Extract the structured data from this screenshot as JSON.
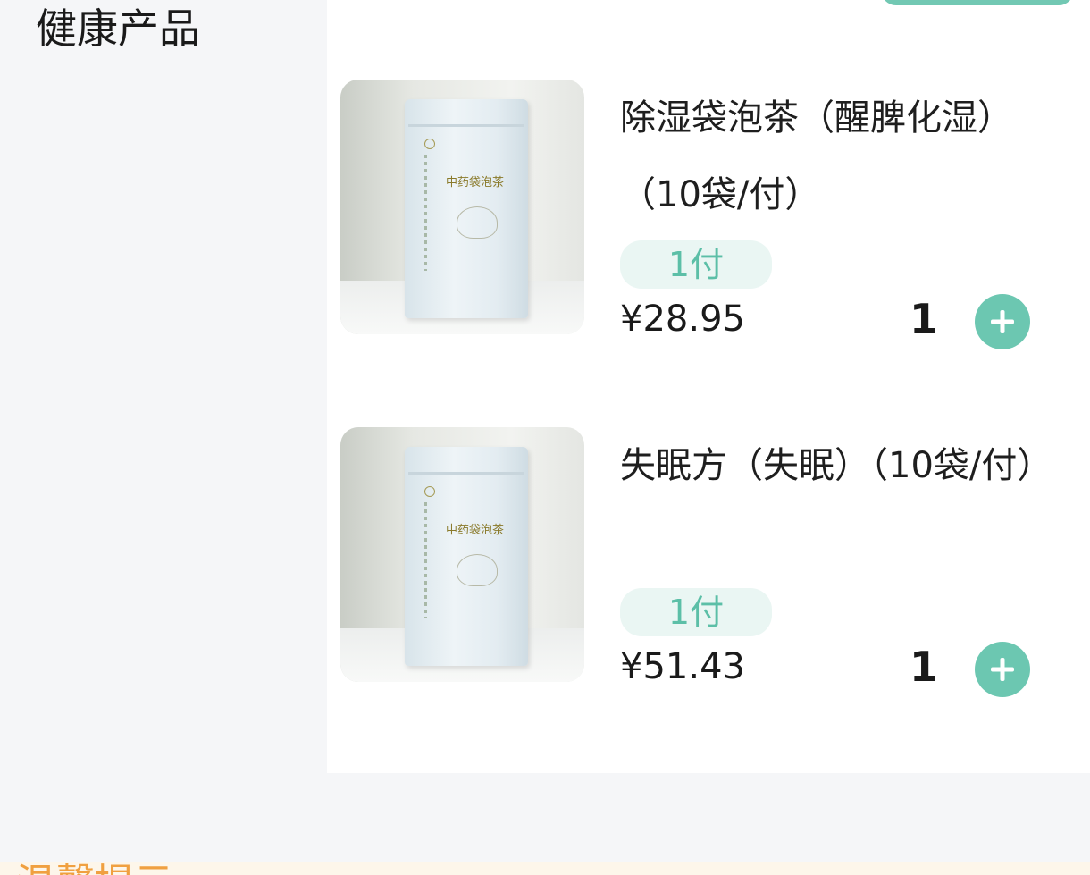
{
  "sidebar": {
    "active_category": "健康产品"
  },
  "products": [
    {
      "name": "除湿袋泡茶（醒脾化湿）（10袋/付）",
      "spec": "1付",
      "price": "¥28.95",
      "quantity": "1",
      "image_label": "中药袋泡茶"
    },
    {
      "name": "失眠方（失眠）（10袋/付）",
      "spec": "1付",
      "price": "¥51.43",
      "quantity": "1",
      "image_label": "中药袋泡茶"
    }
  ],
  "tip": {
    "title": "温馨提示"
  },
  "colors": {
    "accent": "#6cc7b1",
    "badge_bg": "#eaf6f3",
    "badge_text": "#5cbfa7",
    "tip_text": "#f0a040",
    "tip_bg": "#fdf6ea"
  }
}
